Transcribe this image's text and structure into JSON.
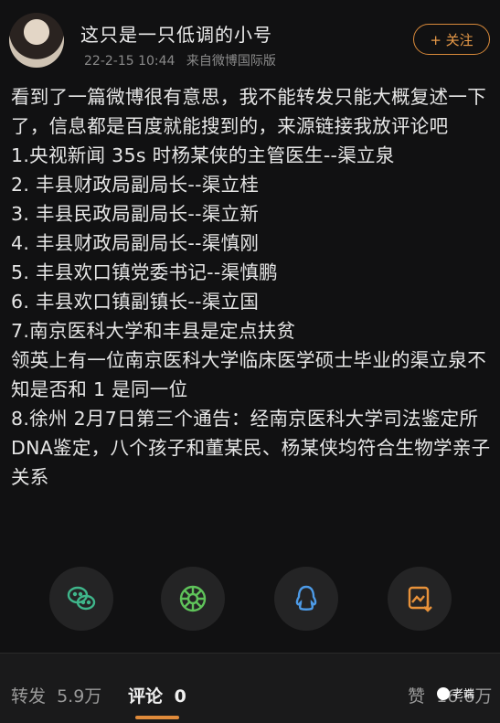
{
  "header": {
    "username": "这只是一只低调的小号",
    "timestamp": "22-2-15 10:44",
    "source": "来自微博国际版",
    "follow_label": "+ 关注"
  },
  "post": {
    "lines": [
      "看到了一篇微博很有意思，我不能转发只能大概复述一下了，信息都是百度就能搜到的，来源链接我放评论吧",
      "1.央视新闻 35s 时杨某侠的主管医生--渠立泉",
      "2. 丰县财政局副局长--渠立桂",
      "3. 丰县民政局副局长--渠立新",
      "4. 丰县财政局副局长--渠慎刚",
      "5. 丰县欢口镇党委书记--渠慎鹏",
      "6. 丰县欢口镇副镇长--渠立国",
      "7.南京医科大学和丰县是定点扶贫",
      "领英上有一位南京医科大学临床医学硕士毕业的渠立泉不知是否和 1 是同一位",
      "8.徐州 2月7日第三个通告：经南京医科大学司法鉴定所DNA鉴定，八个孩子和董某民、杨某侠均符合生物学亲子关系"
    ]
  },
  "share": {
    "icons": [
      "wechat-icon",
      "moments-icon",
      "qq-icon",
      "save-image-icon"
    ],
    "colors": {
      "wechat": "#3fb68b",
      "moments": "#5fc35a",
      "qq": "#4d9be8",
      "save": "#e8923a"
    }
  },
  "footer": {
    "repost_label": "转发",
    "repost_count": "5.9万",
    "comment_label": "评论",
    "comment_count": "0",
    "like_label": "赞",
    "like_count": "16.6万"
  },
  "watermark": "老端"
}
